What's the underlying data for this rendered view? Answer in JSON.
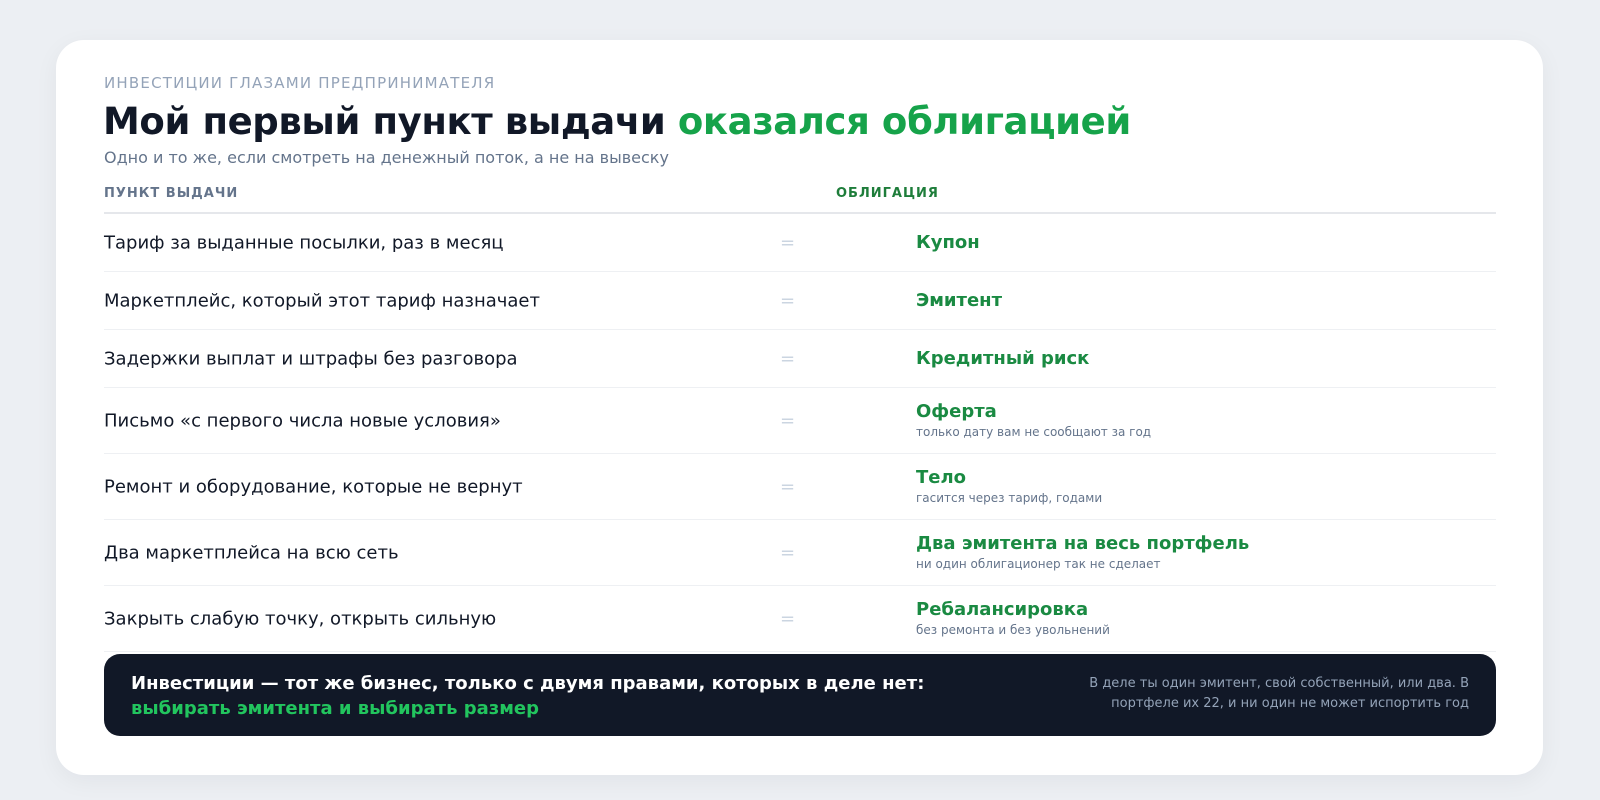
{
  "header": {
    "eyebrow": "ИНВЕСТИЦИИ ГЛАЗАМИ ПРЕДПРИНИМАТЕЛЯ",
    "title_main": "Мой первый пункт выдачи",
    "title_accent": "оказался облигацией",
    "subtitle": "Одно и то же, если смотреть на денежный поток, а не на вывеску"
  },
  "columns": {
    "left": "ПУНКТ ВЫДАЧИ",
    "right": "ОБЛИГАЦИЯ"
  },
  "equals_sign": "=",
  "rows": [
    {
      "left": "Тариф за выданные посылки, раз в месяц",
      "right": "Купон",
      "note": ""
    },
    {
      "left": "Маркетплейс, который этот тариф назначает",
      "right": "Эмитент",
      "note": ""
    },
    {
      "left": "Задержки выплат и штрафы без разговора",
      "right": "Кредитный риск",
      "note": ""
    },
    {
      "left": "Письмо «с первого числа новые условия»",
      "right": "Оферта",
      "note": "только дату вам не сообщают за год"
    },
    {
      "left": "Ремонт и оборудование, которые не вернут",
      "right": "Тело",
      "note": "гасится через тариф, годами"
    },
    {
      "left": "Два маркетплейса на всю сеть",
      "right": "Два эмитента на весь портфель",
      "note": "ни один облигационер так не сделает"
    },
    {
      "left": "Закрыть слабую точку, открыть сильную",
      "right": "Ребалансировка",
      "note": "без ремонта и без увольнений"
    }
  ],
  "footer": {
    "lead": "Инвестиции — тот же бизнес, только с двумя правами, которых в деле нет:",
    "lead_accent": "выбирать эмитента и выбирать размер",
    "aside": "В деле ты один эмитент, свой собственный, или два. В портфеле их 22, и ни один не может испортить год"
  },
  "colors": {
    "accent": "#16a34a",
    "accent_dark": "#1a8a42",
    "footer_bg": "#111827",
    "page_bg": "#eceff3"
  }
}
